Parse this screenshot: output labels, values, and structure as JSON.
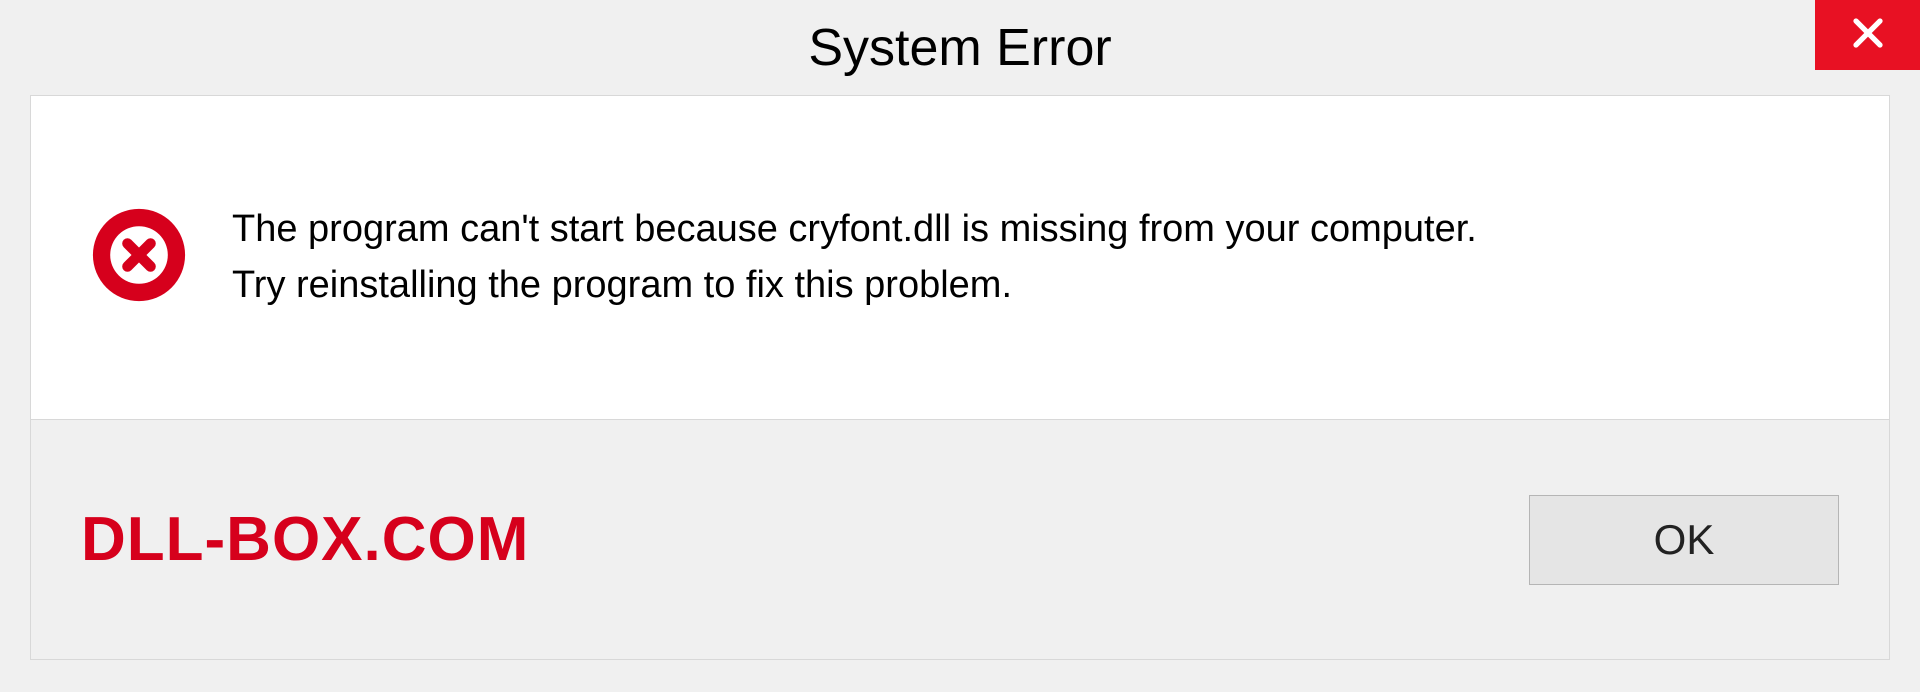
{
  "dialog": {
    "title": "System Error",
    "message_line1": "The program can't start because cryfont.dll is missing from your computer.",
    "message_line2": "Try reinstalling the program to fix this problem.",
    "ok_label": "OK"
  },
  "watermark": "DLL-BOX.COM"
}
